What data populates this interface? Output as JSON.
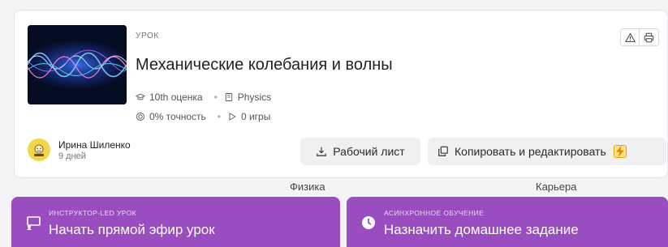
{
  "lesson": {
    "type_label": "УРОК",
    "title": "Механические колебания и волны",
    "grade": "10th оценка",
    "subject": "Physics",
    "accuracy": "0% точность",
    "games": "0 игры"
  },
  "author": {
    "name": "Ирина Шиленко",
    "age": "9 дней"
  },
  "buttons": {
    "worksheet": "Рабочий лист",
    "copy_edit": "Копировать и редактировать"
  },
  "sections": {
    "left": "Физика",
    "right": "Карьера"
  },
  "actions": {
    "live": {
      "sub": "ИНСТРУКТОР-LED УРОК",
      "main": "Начать прямой эфир урок"
    },
    "async": {
      "sub": "АСИНХРОННОЕ ОБУЧЕНИЕ",
      "main": "Назначить домашнее задание"
    }
  },
  "colors": {
    "action_bg": "#9a4dc0",
    "avatar_bg": "#f2d548",
    "button_bg": "#f0f0f3"
  },
  "icons": [
    "graduation-cap-icon",
    "book-icon",
    "target-icon",
    "play-icon",
    "warning-icon",
    "print-icon",
    "download-icon",
    "copy-icon",
    "lightning-icon",
    "presentation-icon",
    "clock-icon"
  ]
}
